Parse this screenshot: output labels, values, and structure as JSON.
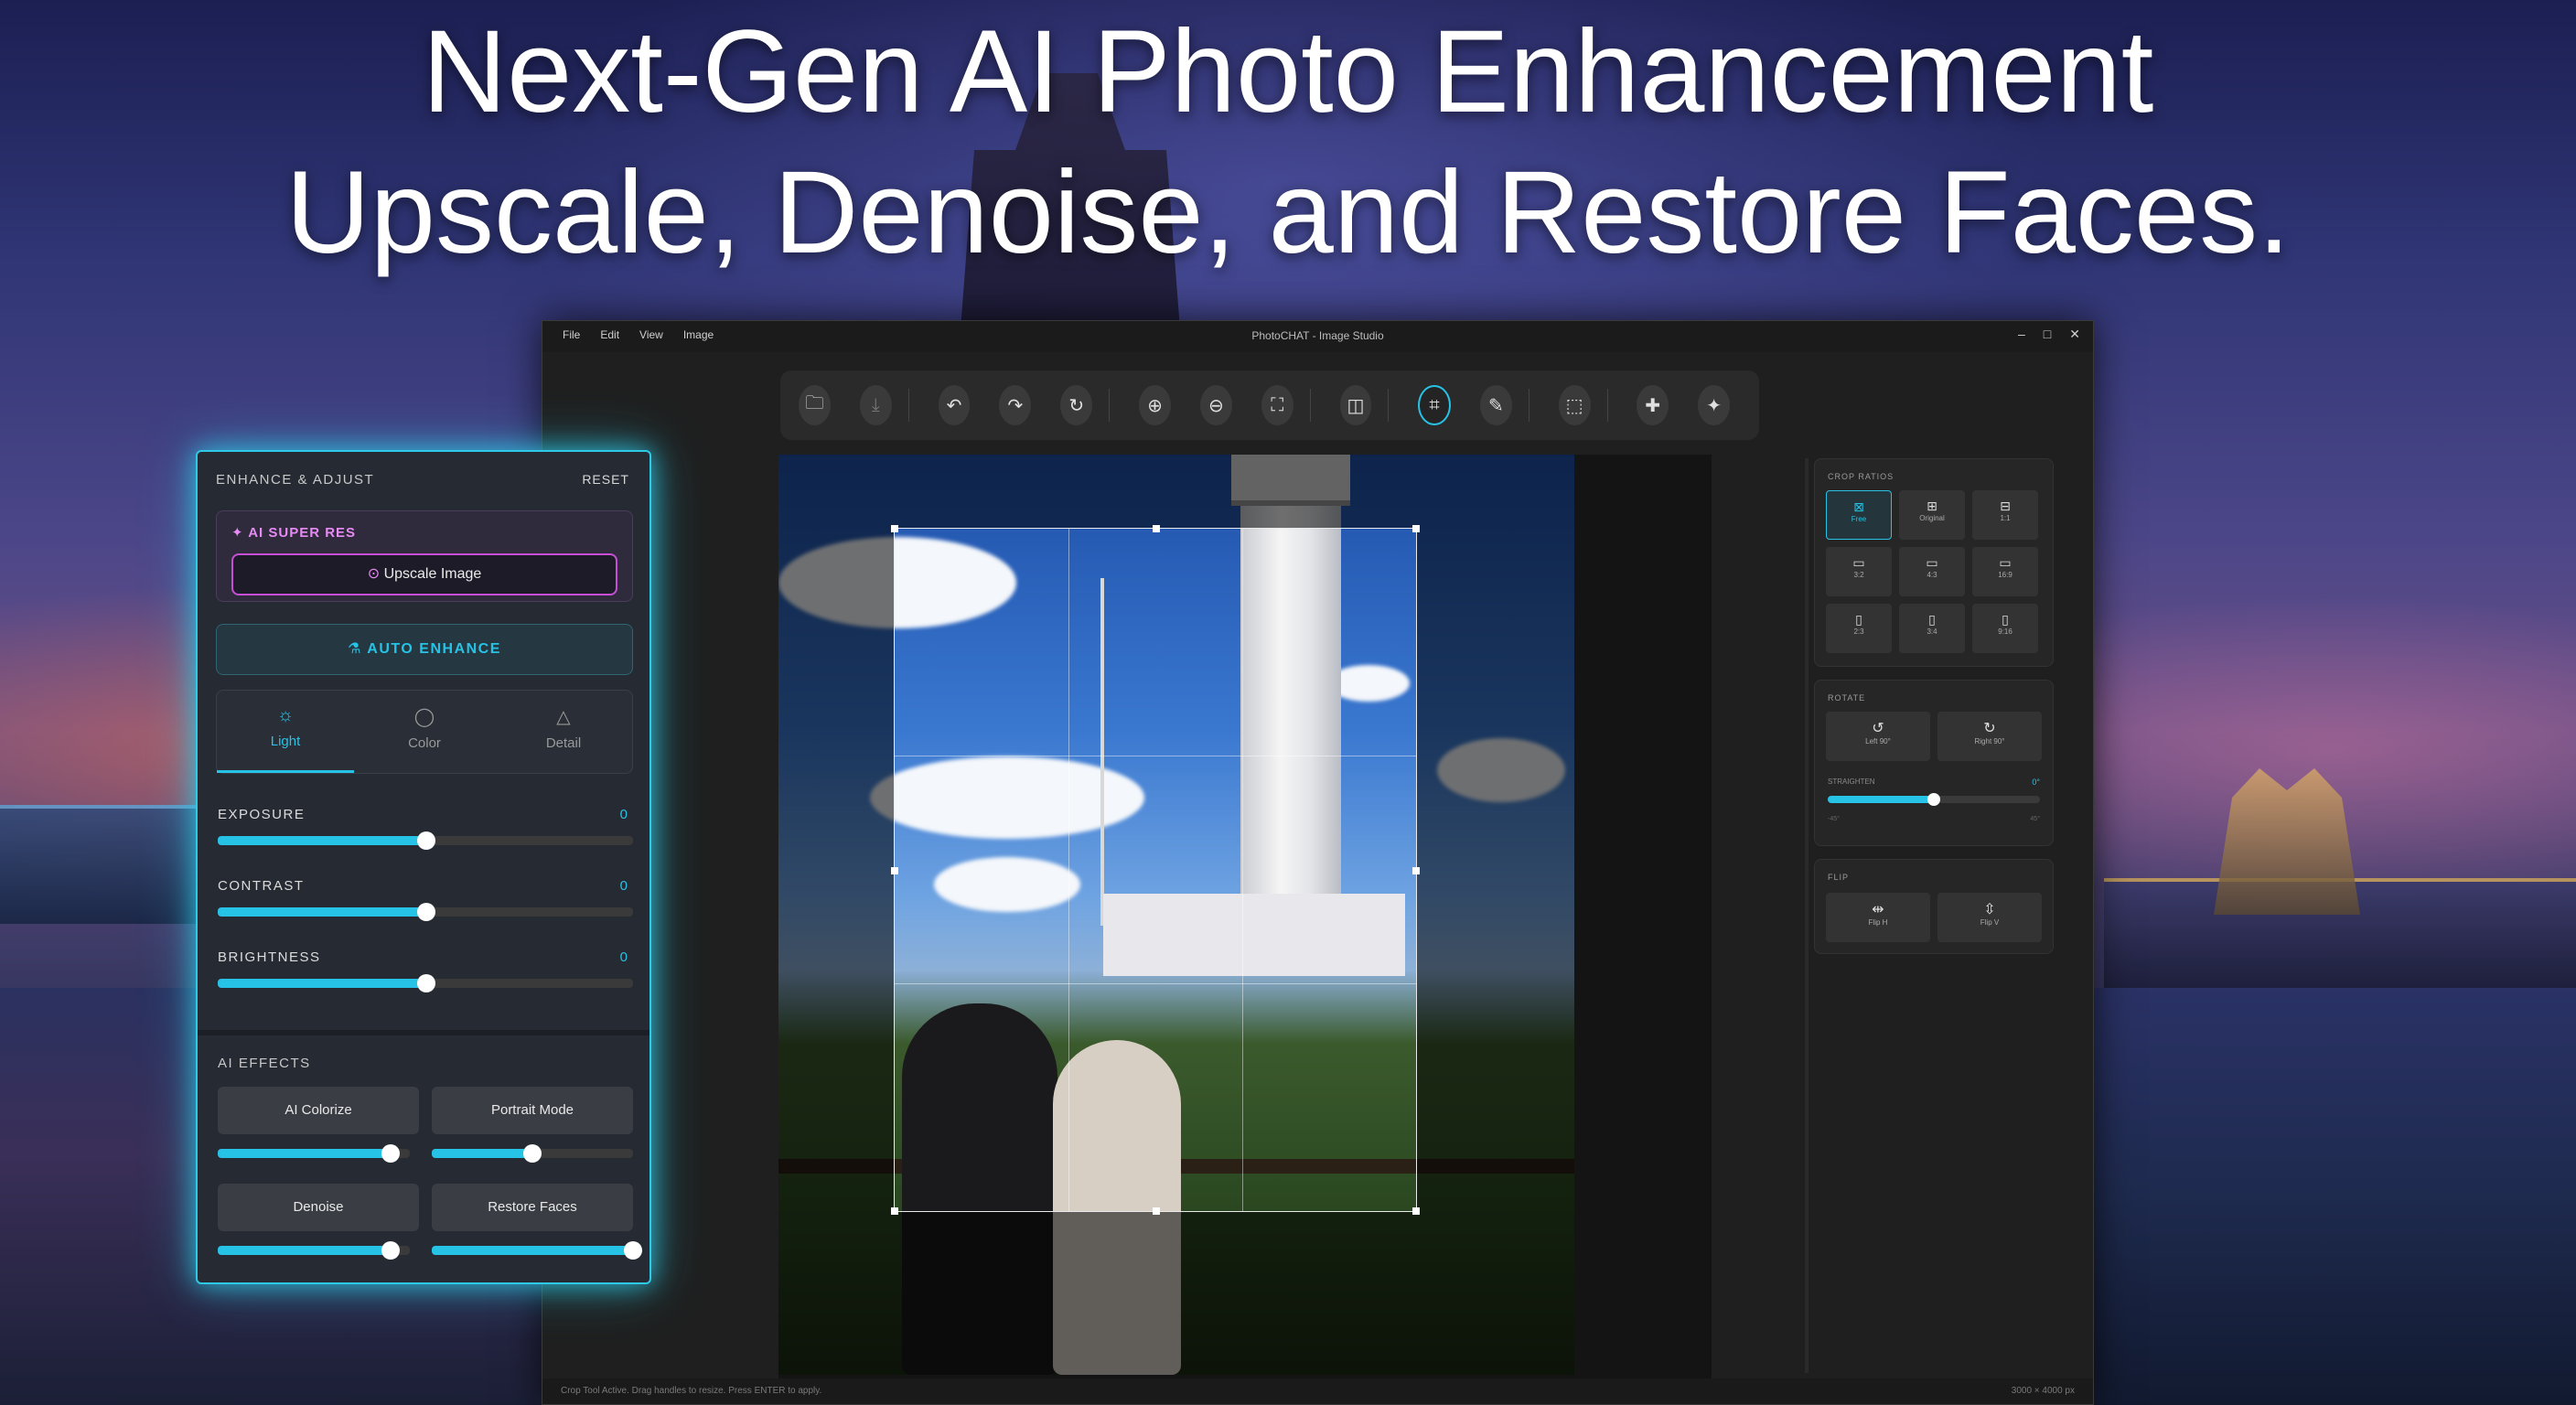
{
  "headline": {
    "line1": "Next-Gen AI Photo Enhancement",
    "line2": "Upscale, Denoise, and Restore Faces."
  },
  "window": {
    "title": "PhotoCHAT - Image Studio",
    "menu": [
      "File",
      "Edit",
      "View",
      "Image"
    ],
    "controls": [
      "–",
      "□",
      "✕"
    ]
  },
  "toolbar": {
    "tools": [
      {
        "name": "open-folder-icon",
        "glyph": "🗀"
      },
      {
        "name": "save-icon",
        "glyph": "⤓"
      },
      {
        "name": "undo-icon",
        "glyph": "↶"
      },
      {
        "name": "redo-icon",
        "glyph": "↷"
      },
      {
        "name": "reset-icon",
        "glyph": "↻"
      },
      {
        "name": "zoom-in-icon",
        "glyph": "⊕"
      },
      {
        "name": "zoom-out-icon",
        "glyph": "⊖"
      },
      {
        "name": "fit-screen-icon",
        "glyph": "⛶"
      },
      {
        "name": "compare-icon",
        "glyph": "◫"
      },
      {
        "name": "crop-icon",
        "glyph": "⌗"
      },
      {
        "name": "pencil-icon",
        "glyph": "✎"
      },
      {
        "name": "text-select-icon",
        "glyph": "⬚"
      },
      {
        "name": "heal-icon",
        "glyph": "✚"
      },
      {
        "name": "magic-wand-icon",
        "glyph": "✦"
      }
    ],
    "active": "crop-icon"
  },
  "right_panel": {
    "crop_ratios_title": "CROP RATIOS",
    "ratios": [
      "Free",
      "Original",
      "1:1",
      "3:2",
      "4:3",
      "16:9",
      "2:3",
      "3:4",
      "9:16"
    ],
    "active_ratio": "Free",
    "rotate_title": "ROTATE",
    "rotate_left": "Left 90°",
    "rotate_right": "Right 90°",
    "straighten_label": "STRAIGHTEN",
    "straighten_value": "0°",
    "straighten_min": "-45°",
    "straighten_max": "45°",
    "flip_title": "FLIP",
    "flip_h": "Flip H",
    "flip_v": "Flip V"
  },
  "statusbar": {
    "left": "Crop Tool Active. Drag handles to resize. Press ENTER to apply.",
    "right": "3000 × 4000 px"
  },
  "enhance_panel": {
    "title": "ENHANCE & ADJUST",
    "reset": "RESET",
    "super_res_label": "AI SUPER RES",
    "upscale_button": "Upscale Image",
    "auto_enhance": "AUTO ENHANCE",
    "tabs": [
      "Light",
      "Color",
      "Detail"
    ],
    "active_tab": "Light",
    "sliders": [
      {
        "label": "EXPOSURE",
        "value": "0"
      },
      {
        "label": "CONTRAST",
        "value": "0"
      },
      {
        "label": "BRIGHTNESS",
        "value": "0"
      }
    ],
    "effects_title": "AI EFFECTS",
    "effects": [
      {
        "label": "AI Colorize",
        "level": 0.9
      },
      {
        "label": "Portrait Mode",
        "level": 0.5
      },
      {
        "label": "Denoise",
        "level": 0.9
      },
      {
        "label": "Restore Faces",
        "level": 1.0
      }
    ]
  },
  "colors": {
    "accent": "#27c3e6",
    "super_res": "#e78af3",
    "panel_bg": "#262a33"
  }
}
